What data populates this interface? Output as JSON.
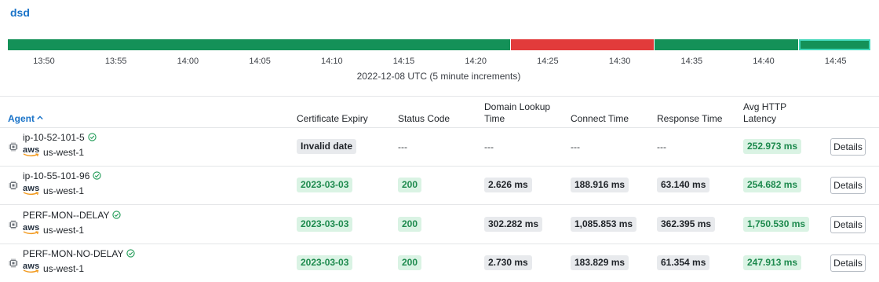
{
  "page": {
    "title": "dsd"
  },
  "timeline": {
    "segments": [
      {
        "status": "ok",
        "frac": 0.584
      },
      {
        "status": "fail",
        "frac": 0.166
      },
      {
        "status": "ok",
        "frac": 0.167
      },
      {
        "status": "ok_selected",
        "frac": 0.083
      }
    ],
    "tick_labels": [
      "13:50",
      "13:55",
      "14:00",
      "14:05",
      "14:10",
      "14:15",
      "14:20",
      "14:25",
      "14:30",
      "14:35",
      "14:40",
      "14:45"
    ],
    "caption": "2022-12-08 UTC (5 minute increments)",
    "colors": {
      "ok": "#149158",
      "fail": "#e23b3b",
      "selected_outline": "#3ed6b8"
    }
  },
  "table": {
    "headers": {
      "agent": "Agent",
      "cert_expiry": "Certificate Expiry",
      "status_code": "Status Code",
      "dns_line1": "Domain Lookup",
      "dns_line2": "Time",
      "connect": "Connect Time",
      "response": "Response Time",
      "latency_line1": "Avg HTTP",
      "latency_line2": "Latency"
    },
    "sort": {
      "column": "agent",
      "direction": "ascending",
      "icon": "chevron-up-icon"
    },
    "details_label": "Details",
    "rows": [
      {
        "agent": "ip-10-52-101-5",
        "provider": "aws",
        "region": "us-west-1",
        "cert_expiry": "Invalid date",
        "cert_style": "gray",
        "status_code": "---",
        "dns": "---",
        "connect": "---",
        "response": "---",
        "latency": "252.973 ms"
      },
      {
        "agent": "ip-10-55-101-96",
        "provider": "aws",
        "region": "us-west-1",
        "cert_expiry": "2023-03-03",
        "cert_style": "green",
        "status_code": "200",
        "dns": "2.626 ms",
        "connect": "188.916 ms",
        "response": "63.140 ms",
        "latency": "254.682 ms"
      },
      {
        "agent": "PERF-MON--DELAY",
        "provider": "aws",
        "region": "us-west-1",
        "cert_expiry": "2023-03-03",
        "cert_style": "green",
        "status_code": "200",
        "dns": "302.282 ms",
        "connect": "1,085.853 ms",
        "response": "362.395 ms",
        "latency": "1,750.530 ms"
      },
      {
        "agent": "PERF-MON-NO-DELAY",
        "provider": "aws",
        "region": "us-west-1",
        "cert_expiry": "2023-03-03",
        "cert_style": "green",
        "status_code": "200",
        "dns": "2.730 ms",
        "connect": "183.829 ms",
        "response": "61.354 ms",
        "latency": "247.913 ms"
      }
    ]
  }
}
